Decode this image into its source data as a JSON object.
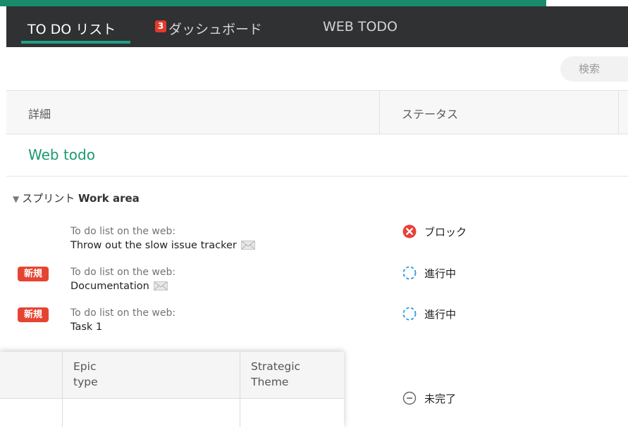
{
  "nav": {
    "tabs": [
      {
        "label": "TO DO リスト",
        "badge": "3",
        "active": true
      },
      {
        "label": "ダッシュボード"
      },
      {
        "label": "WEB TODO"
      }
    ]
  },
  "toolbar": {
    "search_label": "検索"
  },
  "table": {
    "columns": [
      "詳細",
      "ステータス"
    ],
    "project": "Web todo",
    "sprint": {
      "prefix": "スプリント",
      "name": "Work area"
    },
    "tasks": [
      {
        "project": "To do list on the web:",
        "name": "Throw out the slow issue tracker",
        "new": false,
        "status": "ブロック",
        "status_icon": "blocked-icon"
      },
      {
        "project": "To do list on the web:",
        "name": "Documentation",
        "new": true,
        "new_label": "新規",
        "status": "進行中",
        "status_icon": "in-progress-icon"
      },
      {
        "project": "To do list on the web:",
        "name": "Task 1",
        "new": true,
        "new_label": "新規",
        "status": "進行中",
        "status_icon": "in-progress-icon"
      }
    ],
    "extra_status": {
      "label": "未完了",
      "icon": "incomplete-icon"
    }
  },
  "popup": {
    "columns": [
      {
        "line1": "Epic",
        "line2": "type"
      },
      {
        "line1": "Strategic",
        "line2": "Theme"
      }
    ]
  },
  "colors": {
    "accent": "#1a9a6e",
    "top_bar": "#2f3133",
    "badge": "#e23b2e",
    "new_badge": "#e64432",
    "blocked": "#e6433a",
    "in_progress": "#3aa0e6"
  }
}
